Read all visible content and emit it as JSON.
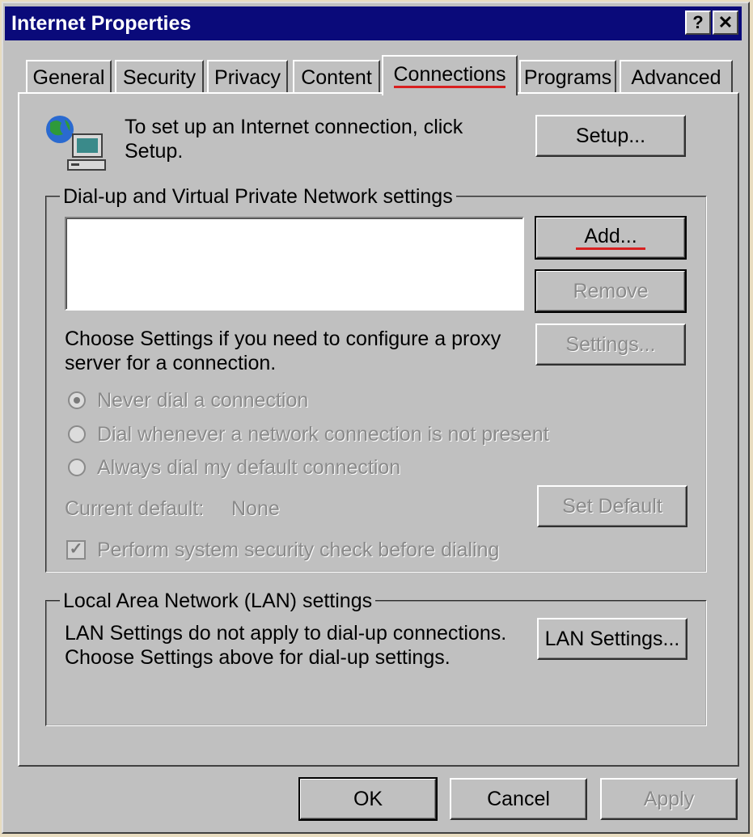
{
  "window": {
    "title": "Internet Properties",
    "help_glyph": "?",
    "close_glyph": "✕"
  },
  "tabs": [
    {
      "label": "General",
      "active": false
    },
    {
      "label": "Security",
      "active": false
    },
    {
      "label": "Privacy",
      "active": false
    },
    {
      "label": "Content",
      "active": false
    },
    {
      "label": "Connections",
      "active": true
    },
    {
      "label": "Programs",
      "active": false
    },
    {
      "label": "Advanced",
      "active": false
    }
  ],
  "setup": {
    "icon": "network-computer-icon",
    "line1": "To set up an Internet connection, click",
    "line2": "Setup.",
    "button": "Setup..."
  },
  "dialup": {
    "legend": "Dial-up and Virtual Private Network settings",
    "add_button": "Add...",
    "remove_button": "Remove",
    "settings_button": "Settings...",
    "proxy_line1": "Choose Settings if you need to configure a proxy",
    "proxy_line2": "server for a connection.",
    "radio_never": "Never dial a connection",
    "radio_whenever": "Dial whenever a network connection is not present",
    "radio_always": "Always dial my default connection",
    "current_default_label": "Current default:",
    "current_default_value": "None",
    "set_default_button": "Set Default",
    "security_check": "Perform system security check before dialing"
  },
  "lan": {
    "legend": "Local Area Network (LAN) settings",
    "line1": "LAN Settings do not apply to dial-up connections.",
    "line2": "Choose Settings above for dial-up settings.",
    "button": "LAN Settings..."
  },
  "footer": {
    "ok": "OK",
    "cancel": "Cancel",
    "apply": "Apply"
  },
  "colors": {
    "titlebar": "#0a0a7a",
    "annotation_red": "#d82020",
    "face": "#c0c0c0"
  }
}
